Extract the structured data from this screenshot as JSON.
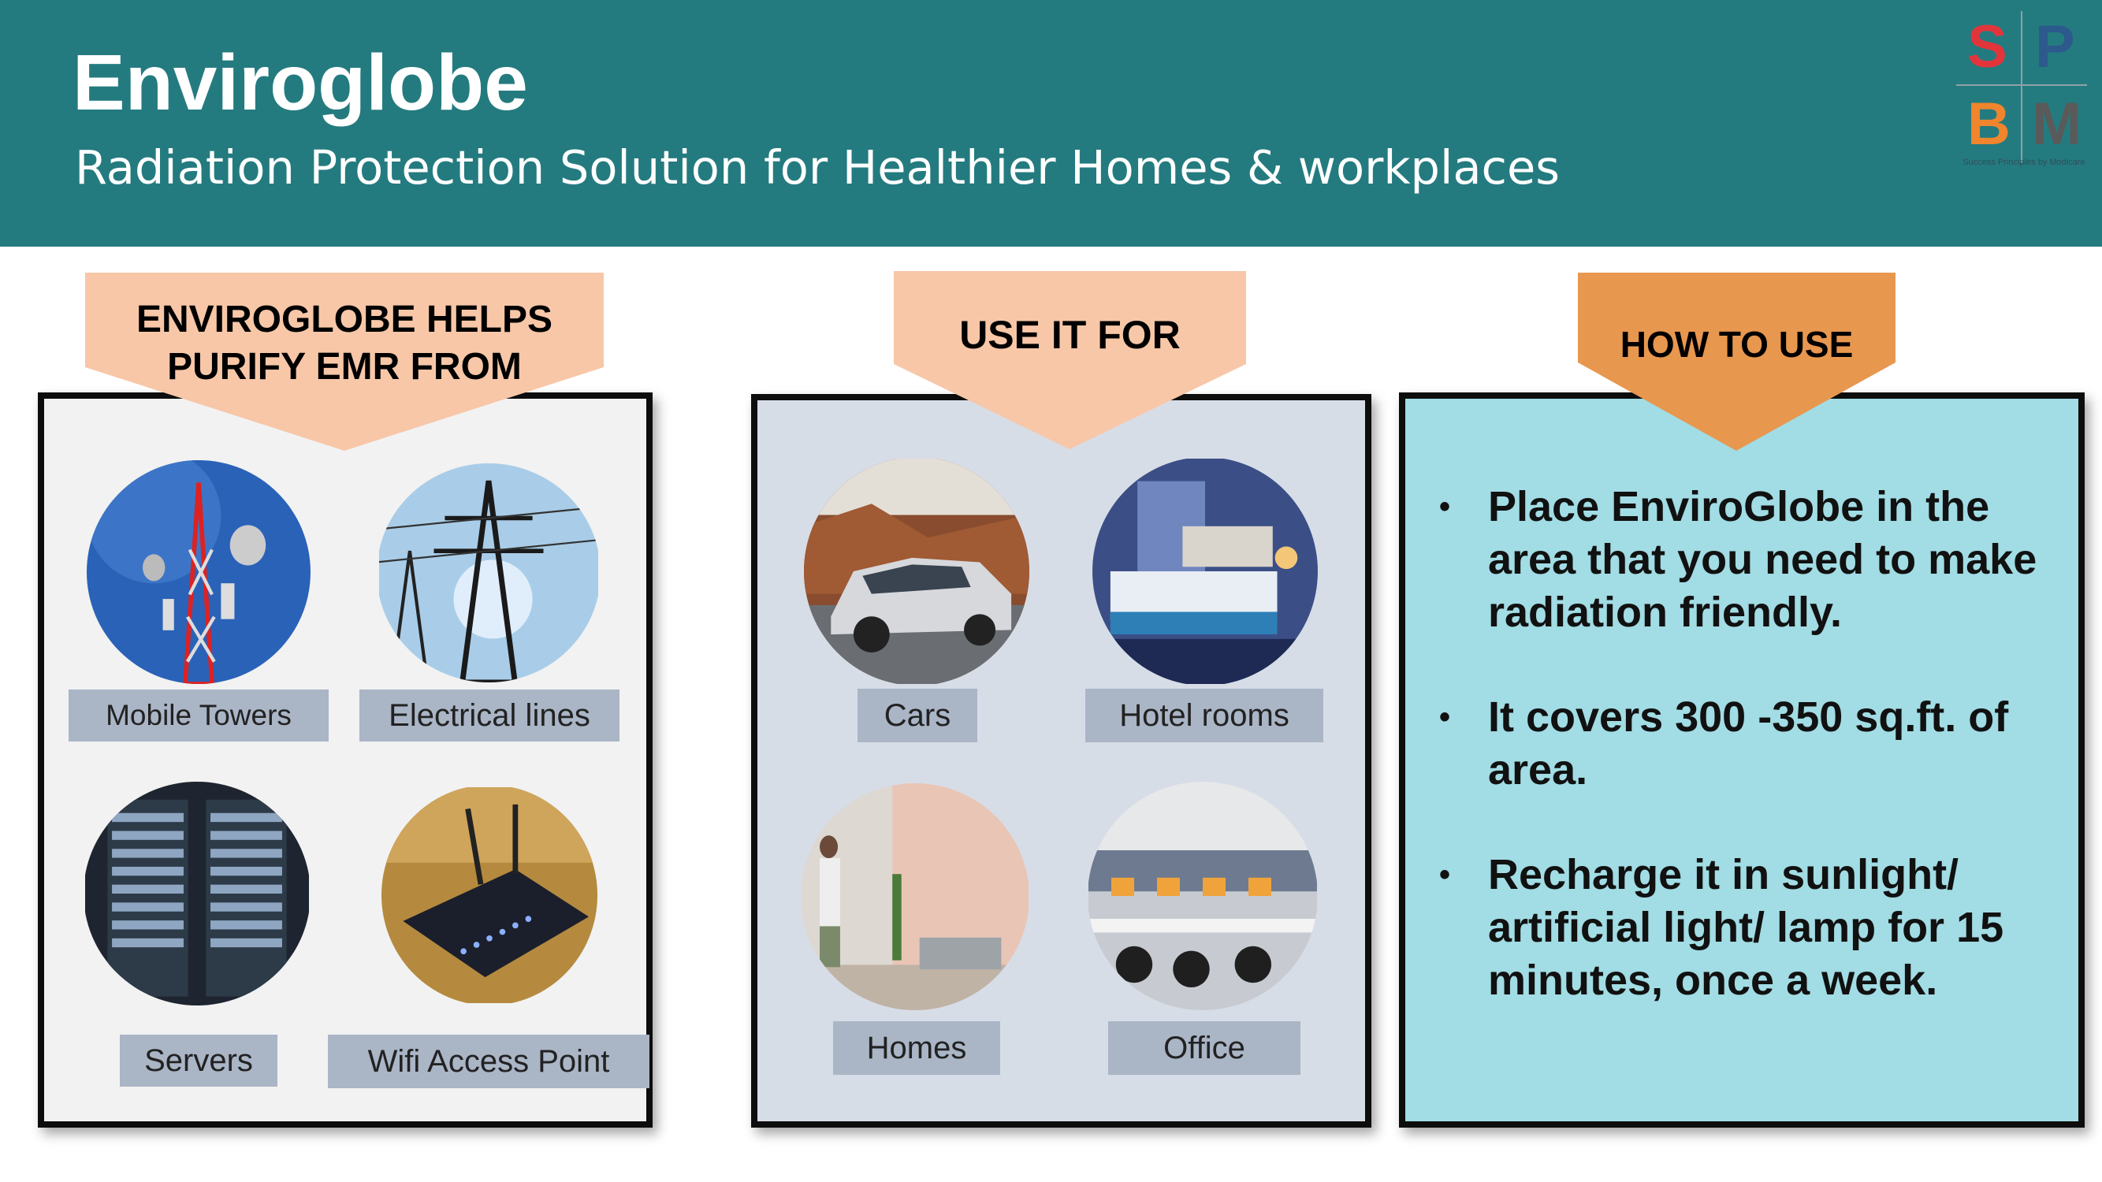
{
  "header": {
    "title": "Enviroglobe",
    "subtitle": "Radiation Protection  Solution for Healthier Homes & workplaces"
  },
  "logo": {
    "letters": [
      "S",
      "P",
      "B",
      "M"
    ],
    "tagline": "Success Principles by Modicare",
    "colors": {
      "S": "#e2353b",
      "P": "#2c5a8c",
      "B": "#f0852d",
      "M": "#5a5a5a"
    }
  },
  "sections": {
    "purify": {
      "banner": [
        "ENVIROGLOBE HELPS",
        "PURIFY  EMR FROM"
      ],
      "items": [
        "Mobile Towers",
        "Electrical lines",
        "Servers",
        "Wifi  Access Point"
      ]
    },
    "use_for": {
      "banner": "USE IT FOR",
      "items": [
        "Cars",
        "Hotel rooms",
        "Homes",
        "Office"
      ]
    },
    "how_to": {
      "banner": "HOW TO USE",
      "bullets": [
        "Place EnviroGlobe in the area that you need to make radiation friendly.",
        " It covers 300 -350 sq.ft. of area.",
        "Recharge it in sunlight/ artificial light/ lamp for 15 minutes, once a week."
      ],
      "bullet_marker": "•"
    }
  },
  "colors": {
    "header_bg": "#247b7f",
    "banner_peach": "#f7c7a8",
    "banner_orange": "#e8974f",
    "panel_gray": "#f2f2f2",
    "panel_blue": "#d7dde7",
    "panel_teal": "#a2dce4",
    "label_bg": "#aab5c6"
  }
}
